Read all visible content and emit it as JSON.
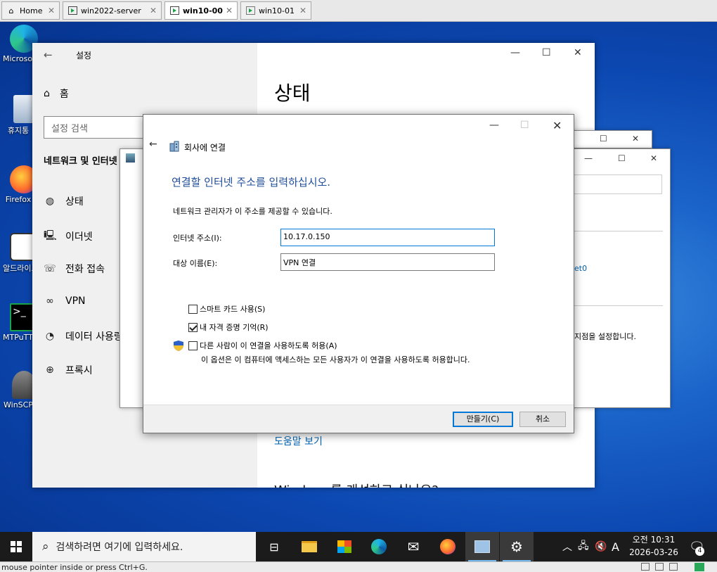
{
  "vmware_tabs": [
    {
      "label": "Home"
    },
    {
      "label": "win2022-server"
    },
    {
      "label": "win10-00"
    },
    {
      "label": "win10-01"
    }
  ],
  "desktop_icons": [
    {
      "label": "Microsoft Edge"
    },
    {
      "label": "휴지통"
    },
    {
      "label": "Firefox"
    },
    {
      "label": "알드라이브"
    },
    {
      "label": "MTPuTTY"
    },
    {
      "label": "WinSCP"
    }
  ],
  "settings": {
    "title": "설정",
    "home": "홈",
    "search_placeholder": "설정 검색",
    "section": "네트워크 및 인터넷",
    "nav": [
      {
        "label": "상태"
      },
      {
        "label": "이더넷"
      },
      {
        "label": "전화 접속"
      },
      {
        "label": "VPN"
      },
      {
        "label": "데이터 사용량"
      },
      {
        "label": "프록시"
      }
    ],
    "main_title": "상태",
    "help_link": "도움말 보기",
    "bottom_text": "Windows를 개선하고 싶나요?"
  },
  "background_window": {
    "link_fragment": "et0",
    "text_fragment": "지점을 설정합니다."
  },
  "dialog": {
    "window_title": "회사에 연결",
    "heading": "연결할 인터넷 주소를 입력하십시오.",
    "description": "네트워크 관리자가 이 주소를 제공할 수 있습니다.",
    "address_label": "인터넷 주소(I):",
    "address_value": "10.17.0.150",
    "dest_label": "대상 이름(E):",
    "dest_value": "VPN 연결",
    "chk_smartcard": {
      "label": "스마트 카드 사용(S)",
      "checked": false
    },
    "chk_remember": {
      "label": "내 자격 증명 기억(R)",
      "checked": true
    },
    "chk_allow": {
      "label": "다른 사람이 이 연결을 사용하도록 허용(A)",
      "checked": false
    },
    "allow_note": "이 옵션은 이 컴퓨터에 액세스하는 모든 사용자가 이 연결을 사용하도록 허용합니다.",
    "create_button": "만들기(C)",
    "cancel_button": "취소"
  },
  "taskbar": {
    "search_placeholder": "검색하려면 여기에 입력하세요.",
    "time": "오전 10:31",
    "date": "2026-03-26",
    "ime": "A",
    "notification_count": "4"
  },
  "statusbar": {
    "text": "mouse pointer inside or press Ctrl+G."
  },
  "colors": {
    "accent": "#0078d7",
    "heading_blue": "#1f4e9a",
    "link_blue": "#0063b1",
    "taskbar": "#1b1b1b"
  }
}
